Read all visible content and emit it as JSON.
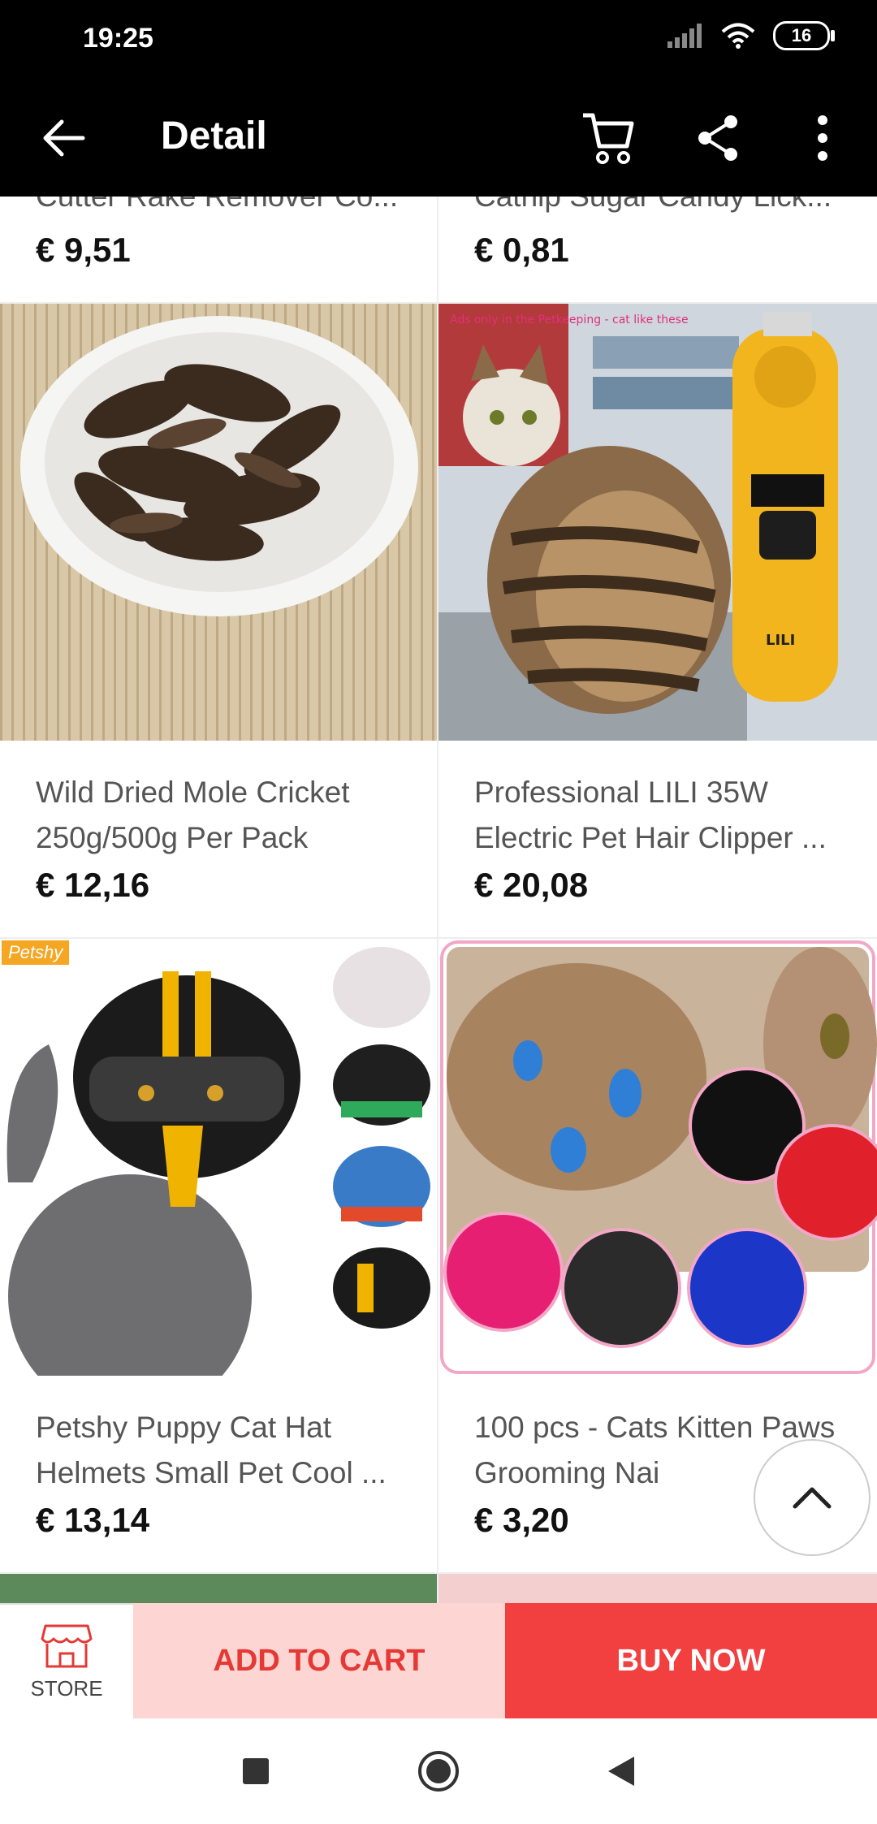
{
  "status_bar": {
    "time": "19:25",
    "battery": "16"
  },
  "app_bar": {
    "title": "Detail"
  },
  "products": [
    {
      "name": "Cutter Rake Remover Co...",
      "price": "€ 9,51"
    },
    {
      "name": "Catnip Sugar Candy Lick...",
      "price": "€ 0,81"
    },
    {
      "name": "Wild Dried Mole Cricket 250g/500g Per Pack",
      "price": "€ 12,16"
    },
    {
      "name": "Professional LILI 35W Electric Pet Hair Clipper ...",
      "price": "€ 20,08",
      "image_text": "Ads only in the Petkeeping - cat like these",
      "product_label": "LILI"
    },
    {
      "name": "Petshy Puppy Cat Hat Helmets Small Pet Cool ...",
      "price": "€ 13,14",
      "badge": "Petshy"
    },
    {
      "name": "100 pcs - Cats Kitten Paws Grooming Nai",
      "price": "€ 3,20"
    }
  ],
  "bottom_bar": {
    "store_label": "STORE",
    "add_to_cart": "ADD TO CART",
    "buy_now": "BUY NOW"
  },
  "colors": {
    "accent": "#f23f3f",
    "accent_light": "#fdd6d4",
    "bar_bg": "#000000"
  }
}
